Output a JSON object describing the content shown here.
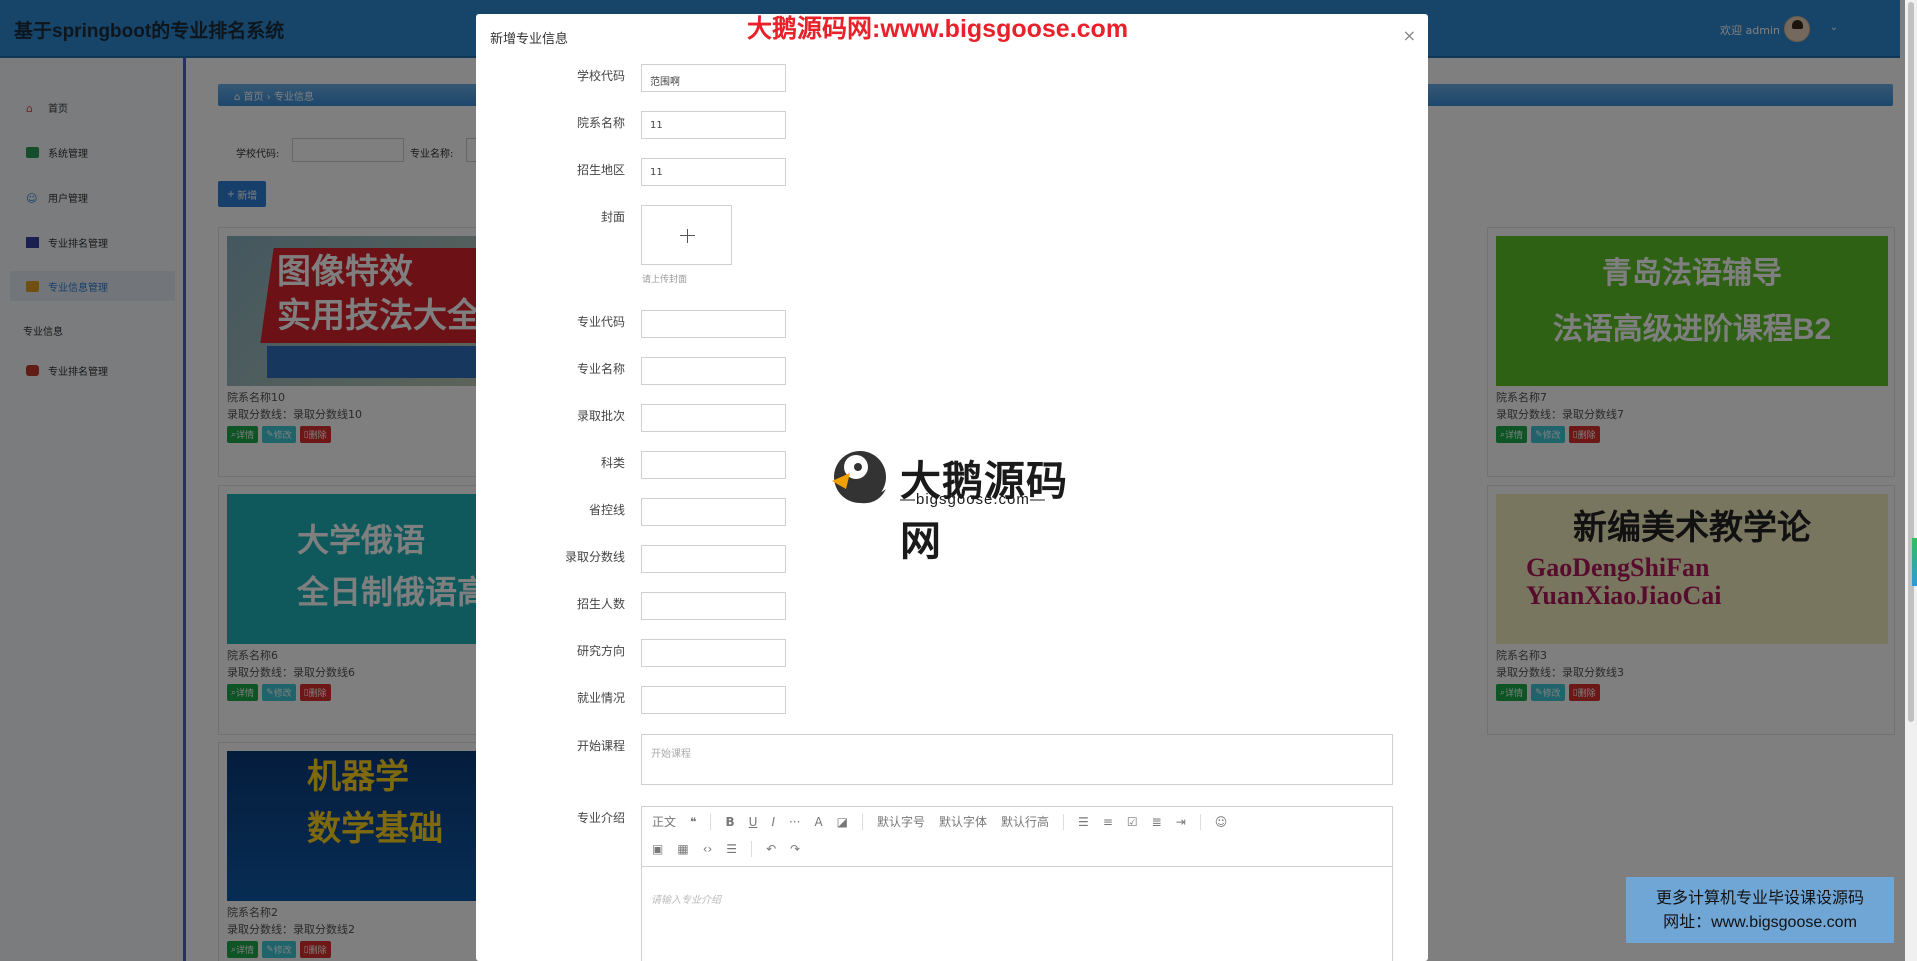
{
  "app": {
    "title": "基于springboot的专业排名系统",
    "welcome": "欢迎 admin"
  },
  "sidebar": {
    "items": [
      {
        "label": "首页",
        "icon": "home-icon"
      },
      {
        "label": "系统管理",
        "icon": "database-icon"
      },
      {
        "label": "用户管理",
        "icon": "user-icon"
      },
      {
        "label": "专业排名管理",
        "icon": "book-icon"
      },
      {
        "label": "专业信息管理",
        "icon": "folder-icon"
      }
    ],
    "group_label": "专业信息",
    "group_items": [
      {
        "label": "专业排名管理",
        "icon": "car-icon"
      }
    ]
  },
  "breadcrumb": {
    "home": "首页",
    "current": "专业信息"
  },
  "search": {
    "school_code_label": "学校代码:",
    "major_name_label": "专业名称:"
  },
  "add_button": "新增",
  "cards": [
    {
      "name": "院系名称10",
      "score": "录取分数线：录取分数线10",
      "image_text": "图像特效\n实用技法大全"
    },
    {
      "name": "院系名称7",
      "score": "录取分数线：录取分数线7",
      "image_text": "青岛法语辅导\n法语高级进阶课程B2"
    },
    {
      "name": "院系名称6",
      "score": "录取分数线：录取分数线6",
      "image_text": "大学俄语\n全日制俄语高级"
    },
    {
      "name": "院系名称3",
      "score": "录取分数线：录取分数线3",
      "image_text": "新编美术教学论"
    },
    {
      "name": "院系名称2",
      "score": "录取分数线：录取分数线2",
      "image_text": "机器学\n数学基础"
    }
  ],
  "card_buttons": {
    "detail": "详情",
    "edit": "修改",
    "delete": "删除"
  },
  "modal": {
    "title": "新增专业信息",
    "fields": [
      {
        "label": "学校代码",
        "value": "范围啊"
      },
      {
        "label": "院系名称",
        "value": "11"
      },
      {
        "label": "招生地区",
        "value": "11"
      },
      {
        "label": "专业代码",
        "value": ""
      },
      {
        "label": "专业名称",
        "value": ""
      },
      {
        "label": "录取批次",
        "value": ""
      },
      {
        "label": "科类",
        "value": ""
      },
      {
        "label": "省控线",
        "value": ""
      },
      {
        "label": "录取分数线",
        "value": ""
      },
      {
        "label": "招生人数",
        "value": ""
      },
      {
        "label": "研究方向",
        "value": ""
      },
      {
        "label": "就业情况",
        "value": ""
      }
    ],
    "cover_label": "封面",
    "cover_hint": "请上传封面",
    "course_label": "开始课程",
    "course_placeholder": "开始课程",
    "intro_label": "专业介绍",
    "intro_placeholder": "请输入专业介绍",
    "toolbar": {
      "paragraph": "正文",
      "font_size": "默认字号",
      "font_family": "默认字体",
      "line_height": "默认行高"
    }
  },
  "watermarks": {
    "top": "大鹅源码网:www.bigsgoose.com",
    "center_title": "大鹅源码网",
    "center_sub": "—bigsgoose.com—",
    "corner_line1": "更多计算机专业毕设课设源码",
    "corner_line2": "网址：www.bigsgoose.com"
  }
}
